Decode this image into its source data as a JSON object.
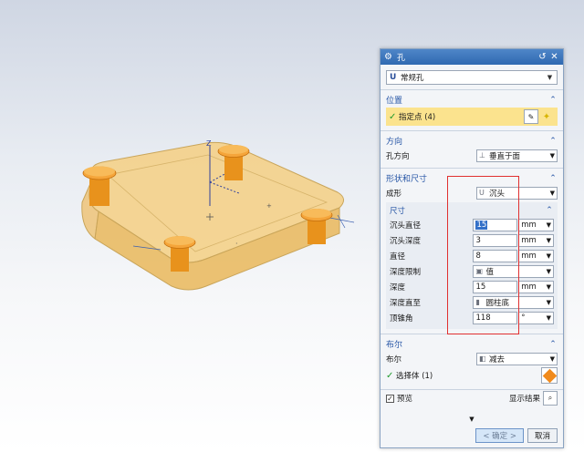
{
  "dialog": {
    "title": "孔",
    "type_value": "常规孔",
    "position": {
      "header": "位置",
      "specify_point": "指定点 (4)"
    },
    "direction": {
      "header": "方向",
      "label": "孔方向",
      "value": "垂直于面"
    },
    "shape": {
      "header": "形状和尺寸",
      "form_label": "成形",
      "form_value": "沉头",
      "dims": {
        "header": "尺寸",
        "rows": [
          {
            "label": "沉头直径",
            "value": "15",
            "unit": "mm"
          },
          {
            "label": "沉头深度",
            "value": "3",
            "unit": "mm"
          },
          {
            "label": "直径",
            "value": "8",
            "unit": "mm"
          },
          {
            "label": "深度限制",
            "value": "值"
          },
          {
            "label": "深度",
            "value": "15",
            "unit": "mm"
          },
          {
            "label": "深度直至",
            "value": "圆柱底"
          },
          {
            "label": "顶锥角",
            "value": "118",
            "unit": "°"
          }
        ]
      }
    },
    "boolean": {
      "header": "布尔",
      "label": "布尔",
      "value": "减去",
      "select_body": "选择体 (1)"
    },
    "preview_label": "预览",
    "show_result_label": "显示结果",
    "ok_label": "< 确定 >",
    "cancel_label": "取消"
  },
  "viewport": {
    "axis_label": "Z"
  },
  "colors": {
    "part": "#f4cf82",
    "post": "#e8921c",
    "accent": "#2756a6",
    "highlight": "#fbe38e",
    "annotation": "#e03030"
  }
}
